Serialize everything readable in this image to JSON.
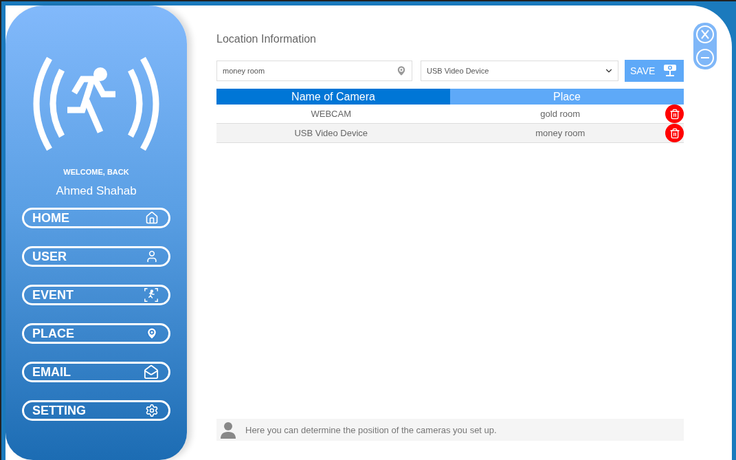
{
  "sidebar": {
    "greeting": "WELCOME, BACK",
    "user_name": "Ahmed Shahab",
    "nav_items": [
      {
        "label": "HOME"
      },
      {
        "label": "USER"
      },
      {
        "label": "EVENT"
      },
      {
        "label": "PLACE"
      },
      {
        "label": "EMAIL"
      },
      {
        "label": "SETTING"
      }
    ]
  },
  "main": {
    "title": "Location Information",
    "place_field": {
      "value": "money room"
    },
    "camera_select": {
      "value": "USB Video Device"
    },
    "save_button": {
      "label": "SAVE"
    },
    "table": {
      "columns": [
        {
          "label": "Name of Camera",
          "selected": true
        },
        {
          "label": "Place",
          "selected": false
        }
      ],
      "rows": [
        {
          "cells": [
            "WEBCAM",
            "gold room"
          ]
        },
        {
          "cells": [
            "USB Video Device",
            "money room"
          ]
        }
      ]
    },
    "hint": "Here you can determine the position of the cameras you set up."
  }
}
